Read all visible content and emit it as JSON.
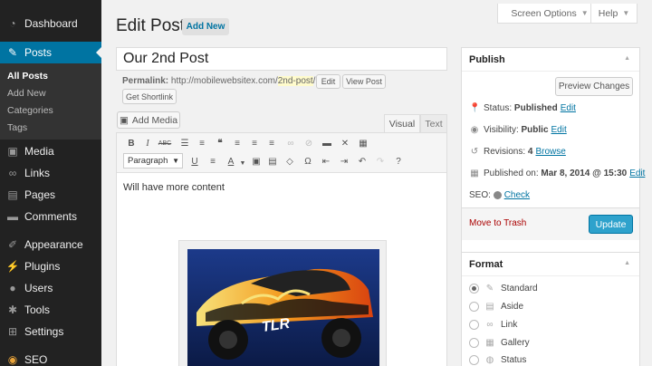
{
  "sidebar": {
    "items": [
      {
        "label": "Dashboard",
        "icon": "dashboard-icon"
      },
      {
        "label": "Posts",
        "icon": "pin-icon"
      },
      {
        "label": "Media",
        "icon": "media-icon"
      },
      {
        "label": "Links",
        "icon": "link-icon"
      },
      {
        "label": "Pages",
        "icon": "pages-icon"
      },
      {
        "label": "Comments",
        "icon": "comments-icon"
      },
      {
        "label": "Appearance",
        "icon": "brush-icon"
      },
      {
        "label": "Plugins",
        "icon": "plugin-icon"
      },
      {
        "label": "Users",
        "icon": "users-icon"
      },
      {
        "label": "Tools",
        "icon": "wrench-icon"
      },
      {
        "label": "Settings",
        "icon": "settings-icon"
      },
      {
        "label": "SEO",
        "icon": "seo-icon"
      }
    ],
    "submenu": [
      "All Posts",
      "Add New",
      "Categories",
      "Tags"
    ]
  },
  "header": {
    "title": "Edit Post",
    "add_new": "Add New",
    "screen_options": "Screen Options",
    "help": "Help"
  },
  "post": {
    "title": "Our 2nd Post",
    "permalink_label": "Permalink:",
    "permalink_base": "http://mobilewebsitex.com/",
    "permalink_slug": "2nd-post",
    "permalink_end": "/",
    "edit_btn": "Edit",
    "view_post_btn": "View Post",
    "shortlink_btn": "Get Shortlink"
  },
  "editor": {
    "add_media": "Add Media",
    "tab_visual": "Visual",
    "tab_text": "Text",
    "format_select": "Paragraph",
    "content": "Will have more content",
    "image_text": "TLR"
  },
  "publish": {
    "title": "Publish",
    "preview": "Preview Changes",
    "status_label": "Status:",
    "status_value": "Published",
    "visibility_label": "Visibility:",
    "visibility_value": "Public",
    "revisions_label": "Revisions:",
    "revisions_value": "4",
    "browse": "Browse",
    "published_label": "Published on:",
    "published_value": "Mar 8, 2014 @ 15:30",
    "seo_label": "SEO:",
    "check": "Check",
    "edit": "Edit",
    "trash": "Move to Trash",
    "update": "Update"
  },
  "format": {
    "title": "Format",
    "selected": "Standard",
    "options": [
      "Standard",
      "Aside",
      "Link",
      "Gallery",
      "Status"
    ]
  },
  "colors": {
    "sidebar_bg": "#222222",
    "accent": "#0074a2",
    "update_button": "#2ea2cc",
    "trash": "#aa0000"
  }
}
